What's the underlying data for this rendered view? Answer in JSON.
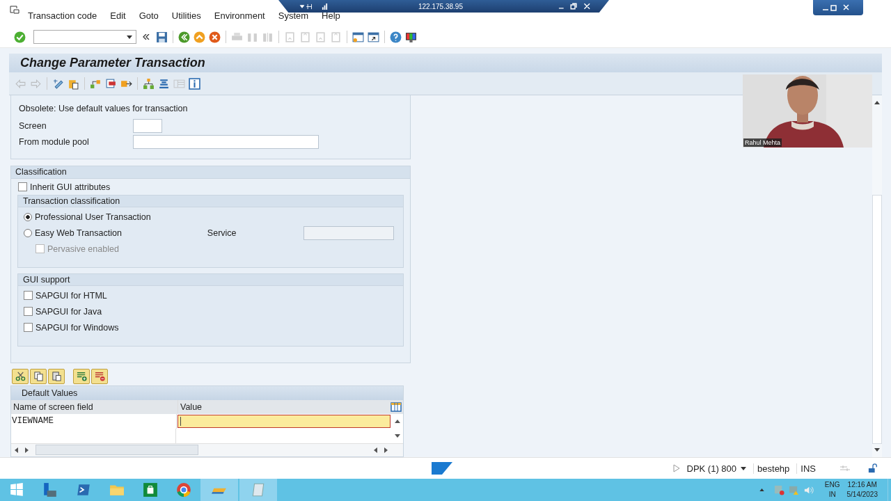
{
  "remote_bar": {
    "address": "122.175.38.95"
  },
  "menu": [
    "Transaction code",
    "Edit",
    "Goto",
    "Utilities",
    "Environment",
    "System",
    "Help"
  ],
  "title": "Change Parameter Transaction",
  "obsolete": {
    "heading": "Obsolete: Use default values for transaction",
    "fields": [
      {
        "label": "Screen",
        "kind": "short"
      },
      {
        "label": "From module pool",
        "kind": "long"
      }
    ]
  },
  "classification": {
    "title": "Classification",
    "inherit_gui": {
      "label": "Inherit GUI attributes",
      "checked": false
    },
    "transaction_classification": {
      "title": "Transaction classification",
      "options": [
        {
          "label": "Professional User Transaction",
          "selected": true
        },
        {
          "label": "Easy Web Transaction",
          "selected": false
        }
      ],
      "service_label": "Service",
      "pervasive": {
        "label": "Pervasive enabled",
        "checked": false,
        "disabled": true
      }
    },
    "gui_support": {
      "title": "GUI support",
      "options": [
        {
          "label": "SAPGUI for HTML",
          "checked": false
        },
        {
          "label": "SAPGUI for Java",
          "checked": false
        },
        {
          "label": "SAPGUI for Windows",
          "checked": false
        }
      ]
    }
  },
  "default_values": {
    "title": "Default Values",
    "columns": [
      "Name of screen field",
      "Value"
    ],
    "rows": [
      {
        "name": "VIEWNAME"
      }
    ]
  },
  "video": {
    "name": "Rahul Mehta"
  },
  "status_bar": {
    "system": "DPK (1) 800",
    "user": "bestehp",
    "mode": "INS"
  },
  "taskbar": {
    "language": "ENG",
    "region": "IN",
    "time": "12:16 AM",
    "date": "5/14/2023"
  }
}
